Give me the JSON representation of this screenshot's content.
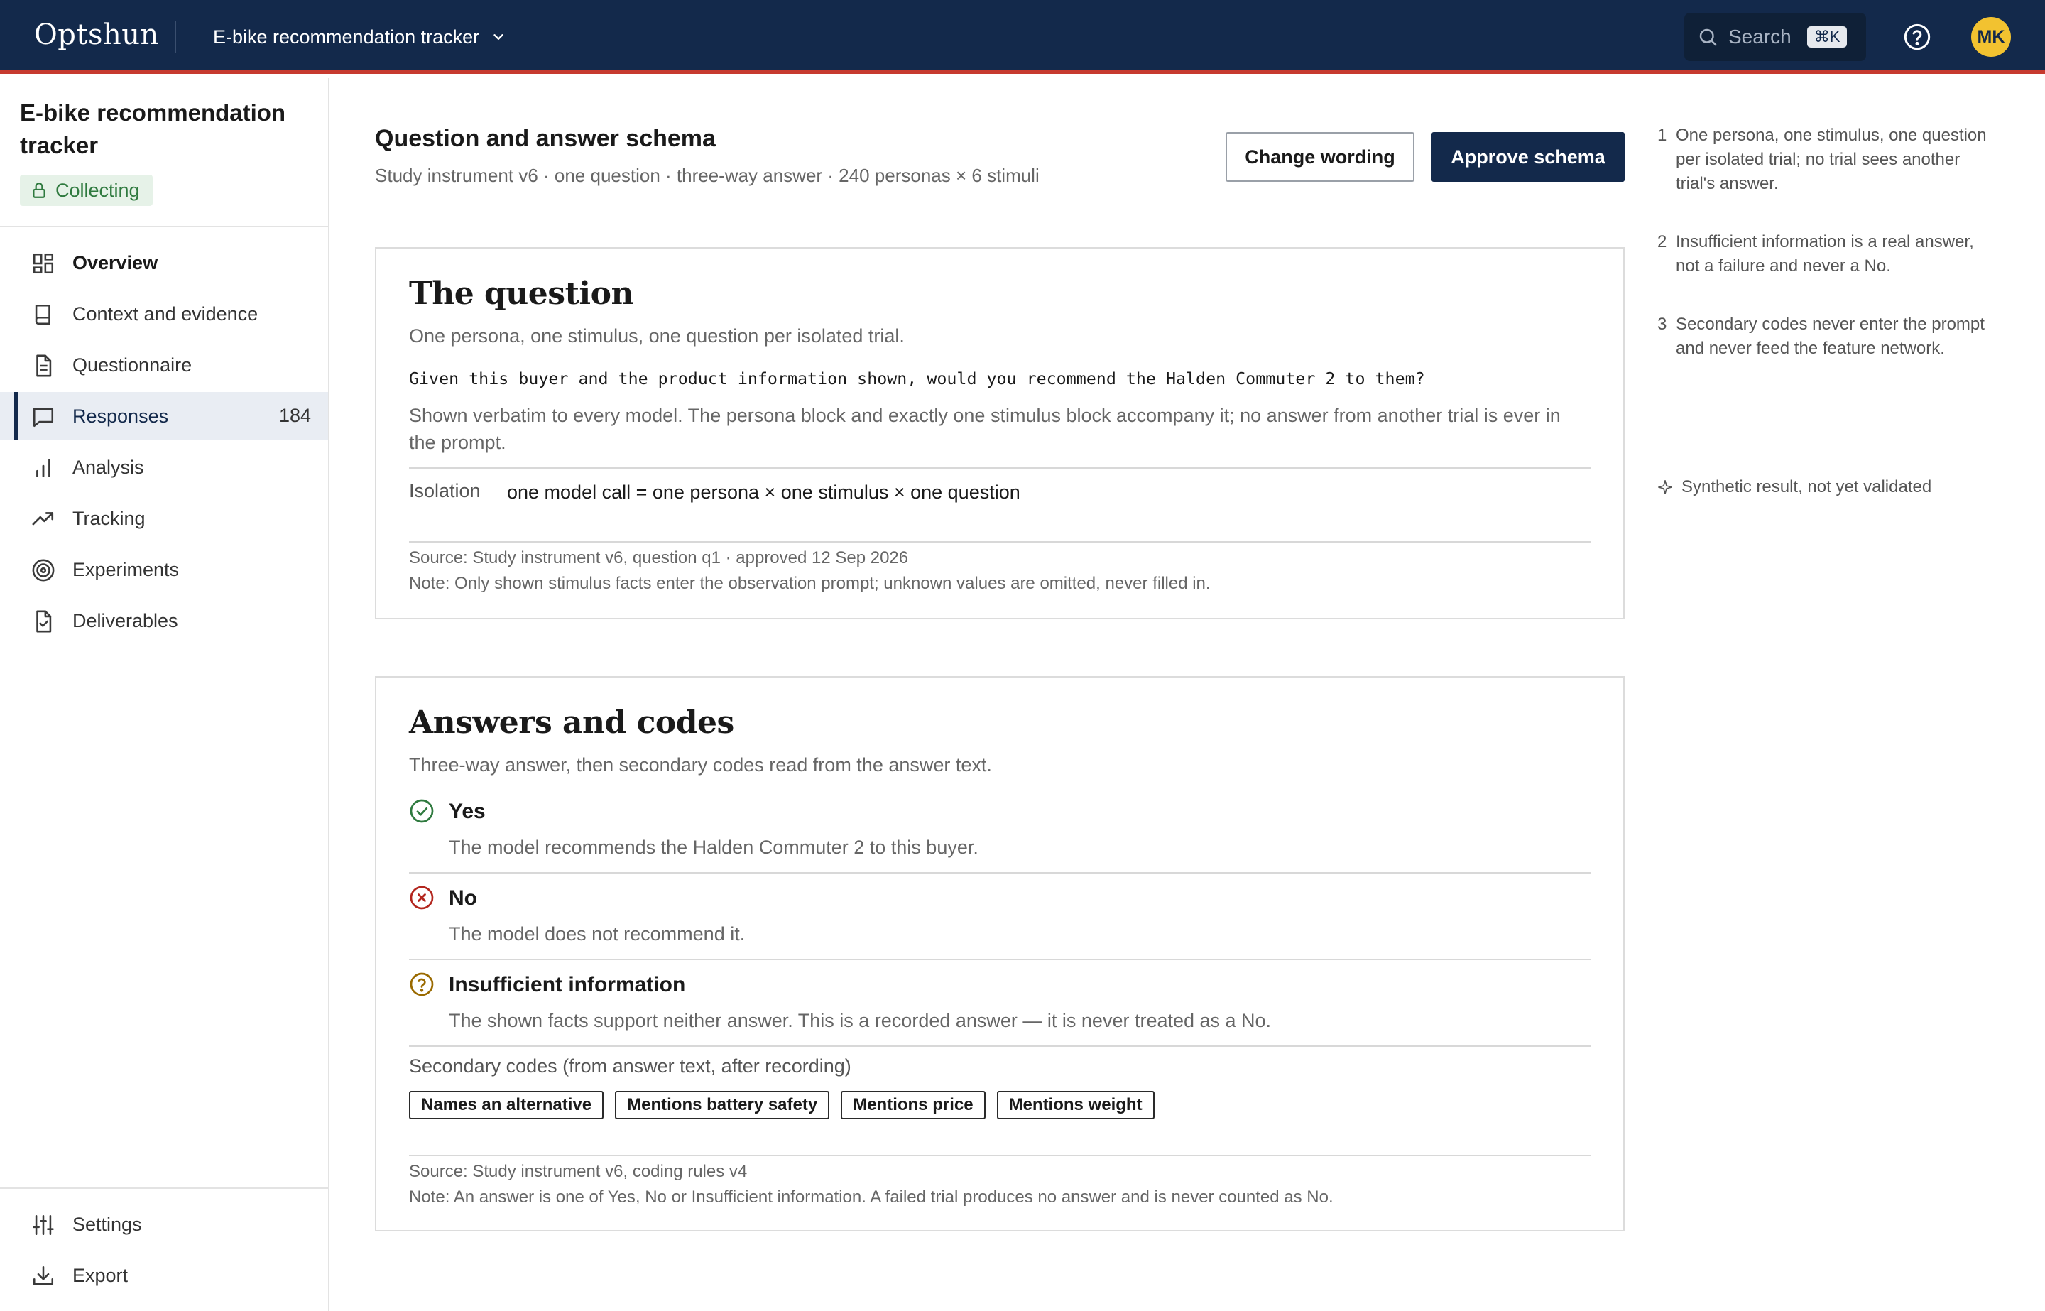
{
  "topbar": {
    "brand": "Optshun",
    "project": "E-bike recommendation tracker",
    "search_label": "Search",
    "search_shortcut": "⌘K",
    "avatar_initials": "MK"
  },
  "sidebar": {
    "project_title": "E-bike recommendation tracker",
    "status": "Collecting",
    "items": [
      {
        "label": "Overview",
        "icon": "dashboard-icon"
      },
      {
        "label": "Context and evidence",
        "icon": "book-icon"
      },
      {
        "label": "Questionnaire",
        "icon": "document-icon"
      },
      {
        "label": "Responses",
        "icon": "chat-icon",
        "count": "184"
      },
      {
        "label": "Analysis",
        "icon": "bar-chart-icon"
      },
      {
        "label": "Tracking",
        "icon": "trend-icon"
      },
      {
        "label": "Experiments",
        "icon": "target-icon"
      },
      {
        "label": "Deliverables",
        "icon": "file-check-icon"
      }
    ],
    "bottom_items": [
      {
        "label": "Settings",
        "icon": "sliders-icon"
      },
      {
        "label": "Export",
        "icon": "download-icon"
      }
    ]
  },
  "header": {
    "title": "Question and answer schema",
    "subtitle": "Study instrument v6 · one question · three-way answer · 240 personas × 6 stimuli",
    "change_wording": "Change wording",
    "approve_schema": "Approve schema"
  },
  "question_card": {
    "heading": "The question",
    "lead": "One persona, one stimulus, one question per isolated trial.",
    "question_text": "Given this buyer and the product information shown, would you recommend the Halden Commuter 2 to them?",
    "description": "Shown verbatim to every model. The persona block and exactly one stimulus block accompany it; no answer from another trial is ever in the prompt.",
    "isolation_label": "Isolation",
    "isolation_value": "one model call = one persona × one stimulus × one question",
    "source": "Source: Study instrument v6, question q1 · approved 12 Sep 2026",
    "note": "Note: Only shown stimulus facts enter the observation prompt; unknown values are omitted, never filled in."
  },
  "answers_card": {
    "heading": "Answers and codes",
    "lead": "Three-way answer, then secondary codes read from the answer text.",
    "answers": [
      {
        "label": "Yes",
        "desc": "The model recommends the Halden Commuter 2 to this buyer.",
        "icon": "check-circle-icon",
        "color": "#2f7a3f"
      },
      {
        "label": "No",
        "desc": "The model does not recommend it.",
        "icon": "x-circle-icon",
        "color": "#b3261e"
      },
      {
        "label": "Insufficient information",
        "desc": "The shown facts support neither answer. This is a recorded answer — it is never treated as a No.",
        "icon": "question-circle-icon",
        "color": "#9a6a00"
      }
    ],
    "secondary_label": "Secondary codes (from answer text, after recording)",
    "codes": [
      "Names an alternative",
      "Mentions battery safety",
      "Mentions price",
      "Mentions weight"
    ],
    "source": "Source: Study instrument v6, coding rules v4",
    "note": "Note: An answer is one of Yes, No or Insufficient information. A failed trial produces no answer and is never counted as No."
  },
  "notes": [
    {
      "num": "1",
      "text": "One persona, one stimulus, one question per isolated trial; no trial sees another trial's answer."
    },
    {
      "num": "2",
      "text": "Insufficient information is a real answer, not a failure and never a No."
    },
    {
      "num": "3",
      "text": "Secondary codes never enter the prompt and never feed the feature network."
    }
  ],
  "synthetic": "Synthetic result, not yet validated",
  "colors": {
    "navy": "#13294b",
    "accent_red": "#c73a2f",
    "avatar_yellow": "#f2c230",
    "status_green": "#2f7a3f"
  }
}
